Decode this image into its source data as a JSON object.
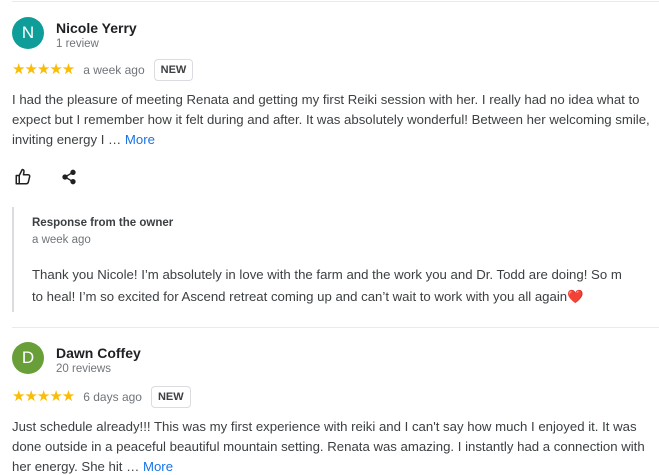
{
  "reviews": [
    {
      "avatar_letter": "N",
      "avatar_color": "#0f9d9a",
      "name": "Nicole Yerry",
      "review_count": "1 review",
      "stars": "★★★★★",
      "date": "a week ago",
      "badge": "NEW",
      "text": "I had the pleasure of meeting Renata and getting my first Reiki session with her. I really had no idea what to expect but I remember how it felt during and after. It was absolutely wonderful! Between her welcoming smile, inviting energy I …",
      "more": "More",
      "owner_response": {
        "title": "Response from the owner",
        "date": "a week ago",
        "line1": "Thank you Nicole! I’m absolutely in love with the farm and the work you and Dr. Todd are doing! So m",
        "line2": "to heal! I’m so excited for Ascend retreat coming up and can’t wait to work with you all again❤️"
      }
    },
    {
      "avatar_letter": "D",
      "avatar_color": "#689f38",
      "name": "Dawn Coffey",
      "review_count": "20 reviews",
      "stars": "★★★★★",
      "date": "6 days ago",
      "badge": "NEW",
      "text": "Just schedule already!!! This was my first experience with reiki and I can't say how much I enjoyed it. It was done outside in a peaceful beautiful mountain setting. Renata was amazing. I instantly had a connection with her energy. She hit …",
      "more": "More"
    }
  ],
  "rating_value": 5,
  "icons": {
    "like": "thumbs-up-icon",
    "share": "share-icon"
  },
  "colors": {
    "star": "#fbbc04",
    "link": "#1a73e8"
  }
}
